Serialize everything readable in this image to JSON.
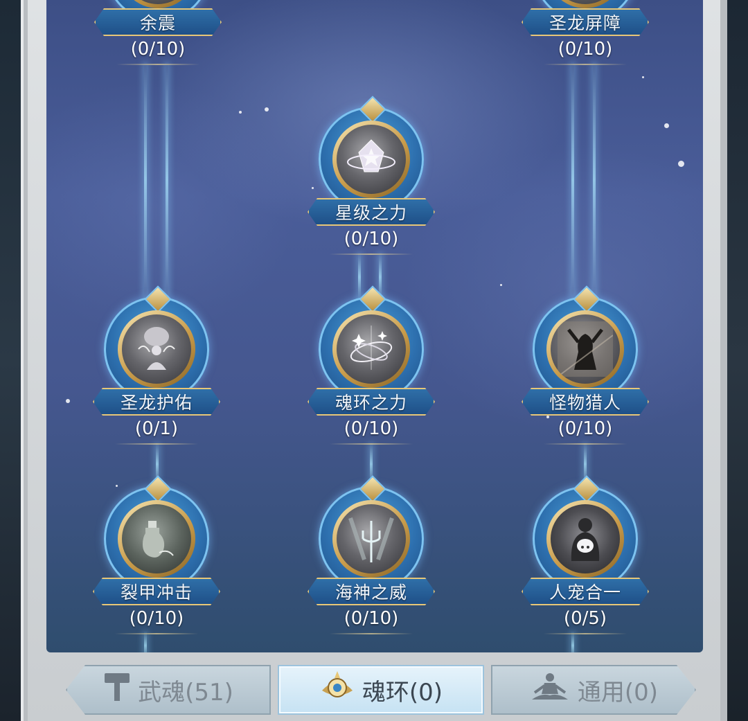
{
  "nodes": [
    {
      "id": "yuzhen",
      "name": "余震",
      "level": "(0/10)",
      "icon": "quake-icon"
    },
    {
      "id": "shenglong-pingzhang",
      "name": "圣龙屏障",
      "level": "(0/10)",
      "icon": "dragon-shield-icon"
    },
    {
      "id": "xingji",
      "name": "星级之力",
      "level": "(0/10)",
      "icon": "star-crystal-icon"
    },
    {
      "id": "shenglong-huyou",
      "name": "圣龙护佑",
      "level": "(0/1)",
      "icon": "dragon-guardian-icon"
    },
    {
      "id": "hunhuan",
      "name": "魂环之力",
      "level": "(0/10)",
      "icon": "soul-ring-icon"
    },
    {
      "id": "guaiwu-lieren",
      "name": "怪物猎人",
      "level": "(0/10)",
      "icon": "monster-hunter-icon"
    },
    {
      "id": "liejia",
      "name": "裂甲冲击",
      "level": "(0/10)",
      "icon": "potion-strike-icon"
    },
    {
      "id": "haishen",
      "name": "海神之威",
      "level": "(0/10)",
      "icon": "trident-icon"
    },
    {
      "id": "renchong",
      "name": "人宠合一",
      "level": "(0/5)",
      "icon": "pet-fusion-icon"
    }
  ],
  "tabs": [
    {
      "label": "武魂(51)",
      "icon": "hammer-icon",
      "active": false
    },
    {
      "label": "魂环(0)",
      "icon": "soul-ring-badge-icon",
      "active": true
    },
    {
      "label": "通用(0)",
      "icon": "meditation-icon",
      "active": false
    }
  ],
  "colors": {
    "tab_active": "#c6e2f3",
    "tab_inactive": "#aebfca",
    "plate": "#2f6fa8",
    "gold": "#e8c777"
  }
}
